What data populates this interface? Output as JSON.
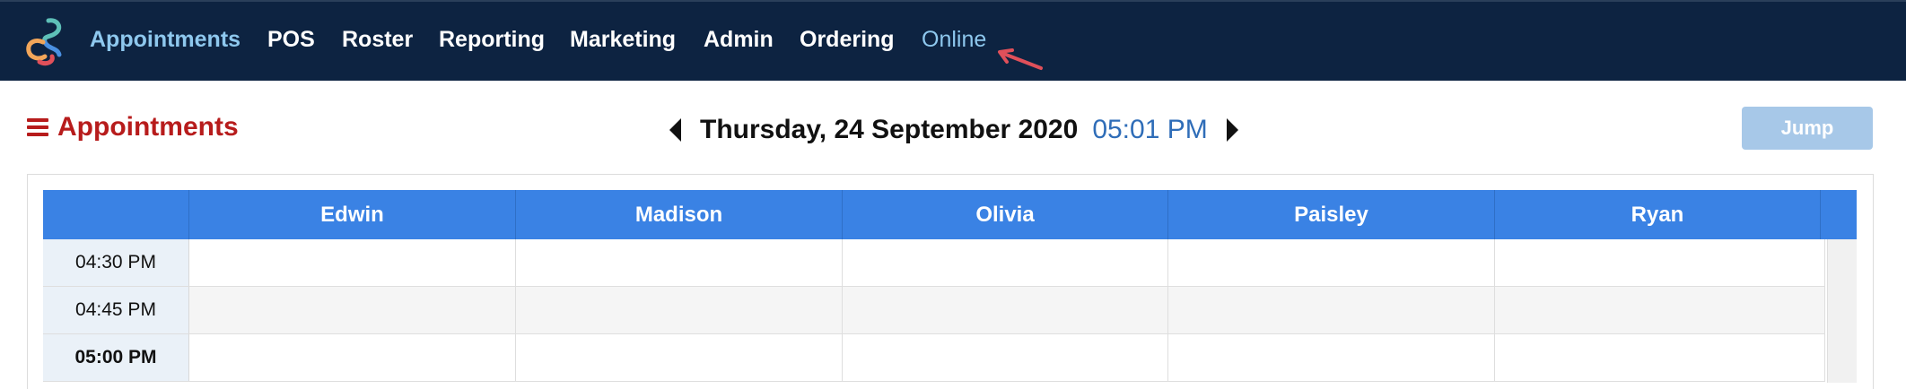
{
  "nav": {
    "items": [
      {
        "label": "Appointments"
      },
      {
        "label": "POS"
      },
      {
        "label": "Roster"
      },
      {
        "label": "Reporting"
      },
      {
        "label": "Marketing"
      },
      {
        "label": "Admin"
      },
      {
        "label": "Ordering"
      },
      {
        "label": "Online"
      }
    ],
    "active_index": 0
  },
  "header": {
    "title": "Appointments",
    "date": "Thursday, 24 September 2020",
    "time": "05:01 PM",
    "jump_label": "Jump"
  },
  "calendar": {
    "staff": [
      "Edwin",
      "Madison",
      "Olivia",
      "Paisley",
      "Ryan"
    ],
    "time_slots": [
      "04:30 PM",
      "04:45 PM",
      "05:00 PM"
    ]
  },
  "colors": {
    "nav_bg": "#0d2341",
    "nav_active": "#8ec8ee",
    "title_red": "#b71c1c",
    "time_blue": "#2f6db8",
    "header_blue": "#3a82e4",
    "jump_bg": "#a7c8e8",
    "annotation_arrow": "#e0505a"
  },
  "icons": [
    "logo-icon",
    "menu-icon",
    "prev-day-icon",
    "next-day-icon",
    "pointer-arrow-icon"
  ]
}
